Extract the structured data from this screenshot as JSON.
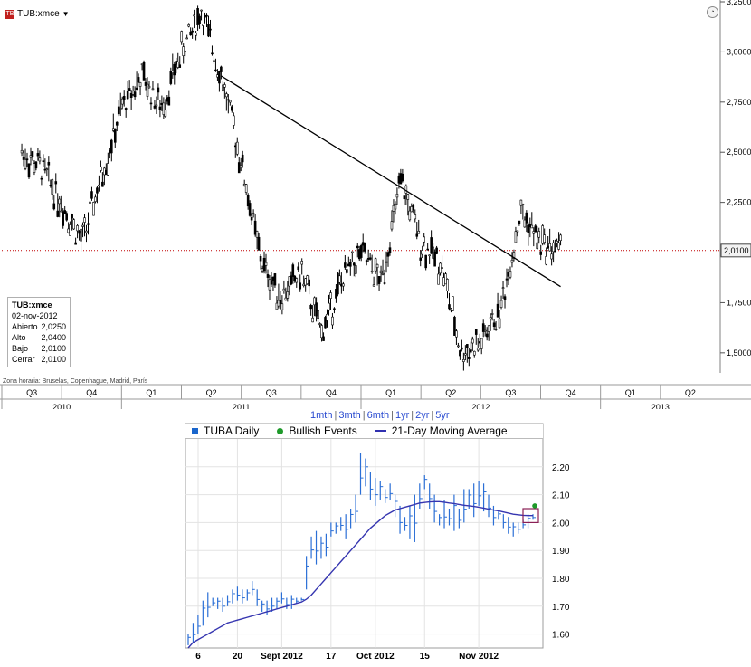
{
  "top_chart": {
    "ticker": "TUB:xmce",
    "timezone": "Zona horaria: Bruselas, Copenhague, Madrid, París",
    "price_label": "2,0100",
    "info": {
      "title": "TUB:xmce",
      "date": "02-nov-2012",
      "rows": [
        {
          "k": "Abierto",
          "v": "2,0250"
        },
        {
          "k": "Alto",
          "v": "2,0400"
        },
        {
          "k": "Bajo",
          "v": "2,0100"
        },
        {
          "k": "Cerrar",
          "v": "2,0100"
        }
      ]
    }
  },
  "bottom_chart": {
    "periods": [
      "1mth",
      "3mth",
      "6mth",
      "1yr",
      "2yr",
      "5yr"
    ],
    "legend": {
      "series": "TUBA Daily",
      "events": "Bullish Events",
      "ma": "21-Day Moving Average"
    }
  },
  "chart_data": [
    {
      "type": "candlestick",
      "ylim": [
        1.4,
        3.25
      ],
      "yticks": [
        "3,2500",
        "3,0000",
        "2,7500",
        "2,5000",
        "2,2500",
        "2,0100",
        "1,7500",
        "1,5000"
      ],
      "x_quarters": [
        "Q3",
        "Q4",
        "Q1",
        "Q2",
        "Q3",
        "Q4",
        "Q1",
        "Q2",
        "Q3",
        "Q4",
        "Q1",
        "Q2"
      ],
      "x_years": [
        "2010",
        "2011",
        "2012",
        "2013"
      ],
      "last_price": 2.01,
      "trendline": {
        "from": {
          "date": "2011-06",
          "value": 2.88
        },
        "to": {
          "date": "2012-11",
          "value": 1.83
        }
      },
      "path": [
        [
          "2010-08",
          2.5
        ],
        [
          "2010-09",
          2.42
        ],
        [
          "2010-10",
          2.25
        ],
        [
          "2010-11",
          2.05
        ],
        [
          "2010-12",
          2.38
        ],
        [
          "2011-01",
          2.72
        ],
        [
          "2011-02",
          2.88
        ],
        [
          "2011-03",
          2.72
        ],
        [
          "2011-04",
          3.0
        ],
        [
          "2011-05",
          3.2
        ],
        [
          "2011-06",
          2.88
        ],
        [
          "2011-07",
          2.45
        ],
        [
          "2011-08",
          1.95
        ],
        [
          "2011-09",
          1.78
        ],
        [
          "2011-10",
          1.9
        ],
        [
          "2011-11",
          1.6
        ],
        [
          "2011-12",
          1.85
        ],
        [
          "2012-01",
          2.0
        ],
        [
          "2012-02",
          1.85
        ],
        [
          "2012-03",
          2.35
        ],
        [
          "2012-04",
          2.05
        ],
        [
          "2012-05",
          1.95
        ],
        [
          "2012-06",
          1.5
        ],
        [
          "2012-07",
          1.55
        ],
        [
          "2012-08",
          1.72
        ],
        [
          "2012-09",
          2.2
        ],
        [
          "2012-10",
          2.05
        ],
        [
          "2012-11",
          2.01
        ]
      ]
    },
    {
      "type": "bar",
      "title": "TUBA Daily",
      "ylim": [
        1.55,
        2.3
      ],
      "yticks": [
        "2.20",
        "2.10",
        "2.00",
        "1.90",
        "1.80",
        "1.70",
        "1.60"
      ],
      "xticks": [
        "6",
        "20",
        "Sept 2012",
        "17",
        "Oct 2012",
        "15",
        "Nov 2012"
      ],
      "daily": [
        [
          1.56,
          1.6
        ],
        [
          1.57,
          1.64
        ],
        [
          1.6,
          1.67
        ],
        [
          1.63,
          1.72
        ],
        [
          1.66,
          1.75
        ],
        [
          1.7,
          1.73
        ],
        [
          1.69,
          1.73
        ],
        [
          1.68,
          1.73
        ],
        [
          1.7,
          1.74
        ],
        [
          1.71,
          1.76
        ],
        [
          1.72,
          1.77
        ],
        [
          1.71,
          1.76
        ],
        [
          1.72,
          1.76
        ],
        [
          1.74,
          1.79
        ],
        [
          1.7,
          1.76
        ],
        [
          1.68,
          1.72
        ],
        [
          1.67,
          1.72
        ],
        [
          1.68,
          1.73
        ],
        [
          1.69,
          1.73
        ],
        [
          1.71,
          1.75
        ],
        [
          1.69,
          1.73
        ],
        [
          1.69,
          1.74
        ],
        [
          1.71,
          1.73
        ],
        [
          1.72,
          1.73
        ],
        [
          1.76,
          1.88
        ],
        [
          1.87,
          1.95
        ],
        [
          1.85,
          1.97
        ],
        [
          1.87,
          1.95
        ],
        [
          1.88,
          1.96
        ],
        [
          1.95,
          2.0
        ],
        [
          1.96,
          2.0
        ],
        [
          1.97,
          2.02
        ],
        [
          1.94,
          2.03
        ],
        [
          1.98,
          2.05
        ],
        [
          2.0,
          2.1
        ],
        [
          2.1,
          2.25
        ],
        [
          2.13,
          2.23
        ],
        [
          2.08,
          2.18
        ],
        [
          2.06,
          2.16
        ],
        [
          2.08,
          2.15
        ],
        [
          2.07,
          2.12
        ],
        [
          2.08,
          2.14
        ],
        [
          2.02,
          2.1
        ],
        [
          1.96,
          2.06
        ],
        [
          1.97,
          2.02
        ],
        [
          1.94,
          2.06
        ],
        [
          1.93,
          2.1
        ],
        [
          2.05,
          2.14
        ],
        [
          2.12,
          2.17
        ],
        [
          2.05,
          2.14
        ],
        [
          2.0,
          2.1
        ],
        [
          1.99,
          2.03
        ],
        [
          1.98,
          2.08
        ],
        [
          1.99,
          2.05
        ],
        [
          1.97,
          2.1
        ],
        [
          1.98,
          2.05
        ],
        [
          2.0,
          2.12
        ],
        [
          2.05,
          2.12
        ],
        [
          2.02,
          2.14
        ],
        [
          2.06,
          2.15
        ],
        [
          2.04,
          2.14
        ],
        [
          2.02,
          2.1
        ],
        [
          1.99,
          2.06
        ],
        [
          2.01,
          2.04
        ],
        [
          1.98,
          2.03
        ],
        [
          1.96,
          2.02
        ],
        [
          1.95,
          2.0
        ],
        [
          1.96,
          2.0
        ],
        [
          1.98,
          2.01
        ],
        [
          1.98,
          2.03
        ],
        [
          2.01,
          2.03
        ]
      ],
      "moving_average": [
        1.55,
        1.57,
        1.58,
        1.59,
        1.6,
        1.61,
        1.62,
        1.63,
        1.64,
        1.645,
        1.65,
        1.655,
        1.66,
        1.665,
        1.67,
        1.675,
        1.68,
        1.685,
        1.69,
        1.695,
        1.7,
        1.705,
        1.71,
        1.715,
        1.725,
        1.74,
        1.76,
        1.78,
        1.8,
        1.82,
        1.84,
        1.86,
        1.88,
        1.9,
        1.92,
        1.94,
        1.96,
        1.98,
        1.995,
        2.01,
        2.025,
        2.035,
        2.045,
        2.05,
        2.055,
        2.06,
        2.065,
        2.07,
        2.072,
        2.074,
        2.075,
        2.075,
        2.073,
        2.07,
        2.068,
        2.065,
        2.062,
        2.06,
        2.058,
        2.055,
        2.052,
        2.048,
        2.045,
        2.042,
        2.038,
        2.034,
        2.03,
        2.028,
        2.026,
        2.025,
        2.025
      ],
      "bullish_event": 2.06
    }
  ]
}
